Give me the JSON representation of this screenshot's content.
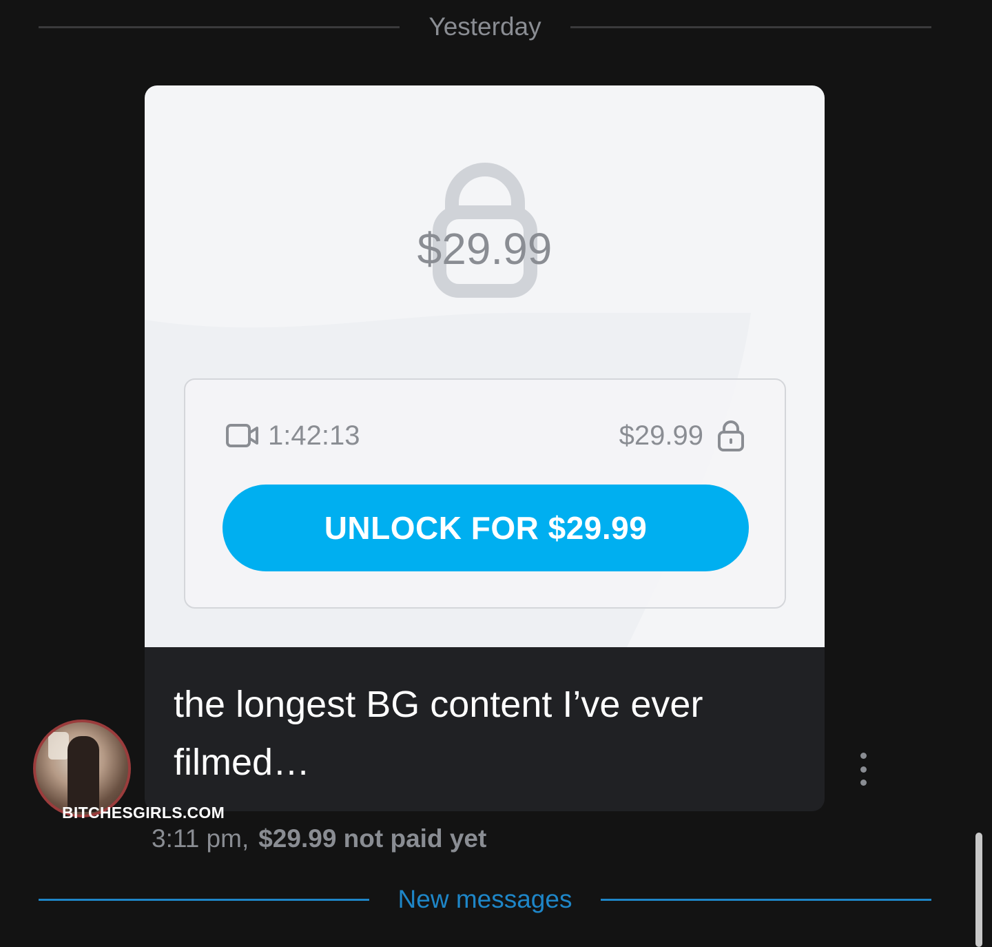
{
  "day_divider": {
    "label": "Yesterday"
  },
  "message": {
    "media": {
      "price_overlay": "$29.99",
      "duration": "1:42:13",
      "price": "$29.99",
      "unlock_label": "UNLOCK FOR $29.99",
      "icons": [
        "lock-icon",
        "video-icon",
        "lock-icon"
      ]
    },
    "caption": "the longest BG content I’ve ever filmed…",
    "time": "3:11 pm,",
    "payment_status": "$29.99 not paid yet"
  },
  "watermark": "BITCHESGIRLS.COM",
  "new_divider": {
    "label": "New messages"
  },
  "colors": {
    "background": "#131313",
    "accent": "#00aff0",
    "link": "#1e86c8",
    "muted": "#8a8d93"
  }
}
